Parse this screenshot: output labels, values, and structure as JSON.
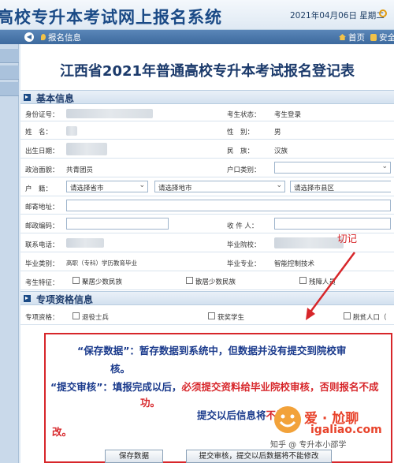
{
  "header": {
    "title": "高校专升本考试网上报名系统",
    "date": "2021年04月06日",
    "weekday": "星期二",
    "date_tail": "⊙"
  },
  "nav": {
    "location": "报名信息",
    "home": "首页",
    "safe": "安全"
  },
  "form": {
    "title": "江西省2021年普通高校专升本考试报名登记表",
    "sections": {
      "basic": "基本信息",
      "special": "专项资格信息"
    },
    "labels": {
      "id_number": "身份证号：",
      "name": "姓　名：",
      "birth": "出生日期：",
      "politics": "政治面貌：",
      "household": "户　籍：",
      "mail_address": "邮寄地址：",
      "postcode": "邮政编码：",
      "phone": "联系电话：",
      "grad_type": "毕业类别：",
      "candidate_feature": "考生特征：",
      "exam_status": "考生状态：",
      "gender": "性　别：",
      "ethnicity": "民　族：",
      "hukou_type": "户口类别：",
      "recipient": "收 件 人：",
      "grad_school": "毕业院校：",
      "grad_major": "毕业专业：",
      "special_qual": "专项资格："
    },
    "values": {
      "exam_status": "考生登录",
      "gender": "男",
      "ethnicity": "汉族",
      "politics": "共青团员",
      "grad_type": "高职（专科）学历教育毕业",
      "grad_major": "智能控制技术",
      "province_placeholder": "请选择省市",
      "city_placeholder": "请选择地市",
      "county_placeholder": "请选择市县区",
      "county_chev": "▾",
      "chev": "⌄"
    },
    "features": [
      "聚居少数民族",
      "散居少数民族",
      "残障人员"
    ],
    "special_options": [
      "退役士兵",
      "获奖学生",
      "脱贫人口（"
    ]
  },
  "annotation": {
    "arrow_label": "切记"
  },
  "note": {
    "line1_blue": "“保存数据”：暂存数据到系统中，但数据并没有提交到院校审",
    "line2_blue": "核。",
    "line3_blue": "“提交审核”：填报完成以后，",
    "line3_red": "必须提交资料给毕业院校审核，否则报名不成",
    "line4_red": "功。",
    "line5_blue": "提交以后信息将",
    "line5_red": "不能修",
    "line6_red": "改。"
  },
  "buttons": {
    "save": "保存数据",
    "submit": "提交审核，提交以后数据将不能修改"
  },
  "watermark": {
    "brand": "爱 · 尬聊",
    "url": "igaliao.com",
    "zhihu": "知乎 @     专升本小邵学"
  }
}
